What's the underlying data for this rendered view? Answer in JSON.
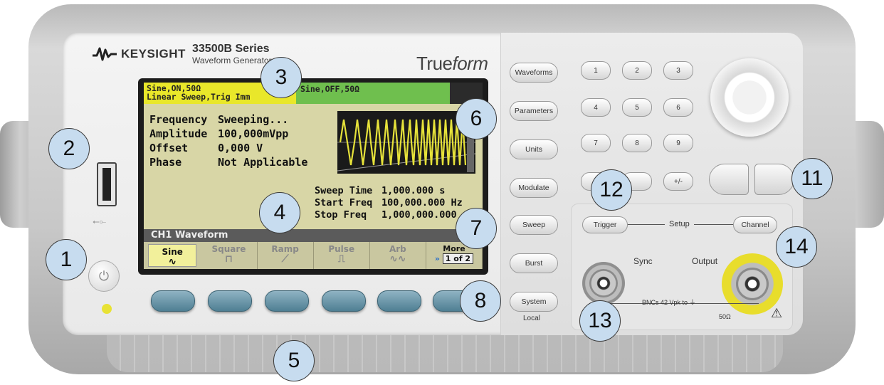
{
  "brand": {
    "name": "KEYSIGHT",
    "logo_icon": "keysight-wave-icon"
  },
  "model": {
    "name": "33500B Series",
    "subtitle": "Waveform Generator"
  },
  "trueform": {
    "pre": "True",
    "italic": "form"
  },
  "display": {
    "ch1_status_line1": "Sine,ON,50Ω",
    "ch1_status_line2": "Linear Sweep,Trig Imm",
    "ch2_status": "Sine,OFF,50Ω",
    "params": [
      {
        "label": "Frequency",
        "value": "Sweeping..."
      },
      {
        "label": "Amplitude",
        "value": "100,000mVpp"
      },
      {
        "label": "Offset",
        "value": "0,000 V"
      },
      {
        "label": "Phase",
        "value": "Not Applicable"
      }
    ],
    "sweep": [
      {
        "label": "Sweep Time",
        "value": "1,000.000 s"
      },
      {
        "label": "Start Freq",
        "value": "100,000.000 Hz"
      },
      {
        "label": "Stop Freq",
        "value": "1,000,000.000"
      }
    ],
    "channel_bar": "CH1 Waveform",
    "softkeys": [
      {
        "label": "Sine",
        "glyph": "∿",
        "active": true
      },
      {
        "label": "Square",
        "glyph": "⊓",
        "active": false
      },
      {
        "label": "Ramp",
        "glyph": "⟋",
        "active": false
      },
      {
        "label": "Pulse",
        "glyph": "⎍",
        "active": false
      },
      {
        "label": "Arb",
        "glyph": "∿∿",
        "active": false
      }
    ],
    "more": {
      "label": "More",
      "page": "1 of 2"
    }
  },
  "front_keys": {
    "waveforms": "Waveforms",
    "parameters": "Parameters",
    "units": "Units",
    "modulate": "Modulate",
    "sweep": "Sweep",
    "burst": "Burst",
    "system": "System",
    "local": "Local"
  },
  "keypad": [
    "1",
    "2",
    "3",
    "4",
    "5",
    "6",
    "7",
    "8",
    "9",
    "+/-"
  ],
  "setup": {
    "trigger": "Trigger",
    "setup": "Setup",
    "channel": "Channel"
  },
  "connectors": {
    "sync": "Sync",
    "output": "Output",
    "note": "BNCs 42 Vpk to ⏚",
    "impedance": "50Ω",
    "warning": "⚠"
  },
  "callouts": [
    "1",
    "2",
    "3",
    "4",
    "5",
    "6",
    "7",
    "8",
    "11",
    "12",
    "13",
    "14"
  ],
  "colors": {
    "callout_fill": "#c7dcef",
    "lcd_bg": "#d8d6a6",
    "ch1_header": "#e9e72a",
    "ch2_header": "#6fbf4e",
    "waveform": "#e6e23a",
    "output_ring": "#e8dd2c"
  }
}
